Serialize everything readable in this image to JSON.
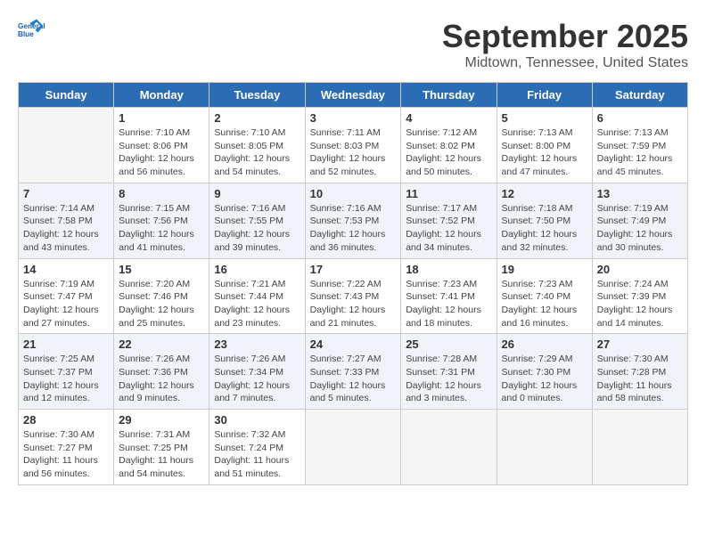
{
  "header": {
    "title": "September 2025",
    "location": "Midtown, Tennessee, United States",
    "logo_general": "General",
    "logo_blue": "Blue"
  },
  "weekdays": [
    "Sunday",
    "Monday",
    "Tuesday",
    "Wednesday",
    "Thursday",
    "Friday",
    "Saturday"
  ],
  "weeks": [
    [
      {
        "day": "",
        "info": ""
      },
      {
        "day": "1",
        "info": "Sunrise: 7:10 AM\nSunset: 8:06 PM\nDaylight: 12 hours\nand 56 minutes."
      },
      {
        "day": "2",
        "info": "Sunrise: 7:10 AM\nSunset: 8:05 PM\nDaylight: 12 hours\nand 54 minutes."
      },
      {
        "day": "3",
        "info": "Sunrise: 7:11 AM\nSunset: 8:03 PM\nDaylight: 12 hours\nand 52 minutes."
      },
      {
        "day": "4",
        "info": "Sunrise: 7:12 AM\nSunset: 8:02 PM\nDaylight: 12 hours\nand 50 minutes."
      },
      {
        "day": "5",
        "info": "Sunrise: 7:13 AM\nSunset: 8:00 PM\nDaylight: 12 hours\nand 47 minutes."
      },
      {
        "day": "6",
        "info": "Sunrise: 7:13 AM\nSunset: 7:59 PM\nDaylight: 12 hours\nand 45 minutes."
      }
    ],
    [
      {
        "day": "7",
        "info": "Sunrise: 7:14 AM\nSunset: 7:58 PM\nDaylight: 12 hours\nand 43 minutes."
      },
      {
        "day": "8",
        "info": "Sunrise: 7:15 AM\nSunset: 7:56 PM\nDaylight: 12 hours\nand 41 minutes."
      },
      {
        "day": "9",
        "info": "Sunrise: 7:16 AM\nSunset: 7:55 PM\nDaylight: 12 hours\nand 39 minutes."
      },
      {
        "day": "10",
        "info": "Sunrise: 7:16 AM\nSunset: 7:53 PM\nDaylight: 12 hours\nand 36 minutes."
      },
      {
        "day": "11",
        "info": "Sunrise: 7:17 AM\nSunset: 7:52 PM\nDaylight: 12 hours\nand 34 minutes."
      },
      {
        "day": "12",
        "info": "Sunrise: 7:18 AM\nSunset: 7:50 PM\nDaylight: 12 hours\nand 32 minutes."
      },
      {
        "day": "13",
        "info": "Sunrise: 7:19 AM\nSunset: 7:49 PM\nDaylight: 12 hours\nand 30 minutes."
      }
    ],
    [
      {
        "day": "14",
        "info": "Sunrise: 7:19 AM\nSunset: 7:47 PM\nDaylight: 12 hours\nand 27 minutes."
      },
      {
        "day": "15",
        "info": "Sunrise: 7:20 AM\nSunset: 7:46 PM\nDaylight: 12 hours\nand 25 minutes."
      },
      {
        "day": "16",
        "info": "Sunrise: 7:21 AM\nSunset: 7:44 PM\nDaylight: 12 hours\nand 23 minutes."
      },
      {
        "day": "17",
        "info": "Sunrise: 7:22 AM\nSunset: 7:43 PM\nDaylight: 12 hours\nand 21 minutes."
      },
      {
        "day": "18",
        "info": "Sunrise: 7:23 AM\nSunset: 7:41 PM\nDaylight: 12 hours\nand 18 minutes."
      },
      {
        "day": "19",
        "info": "Sunrise: 7:23 AM\nSunset: 7:40 PM\nDaylight: 12 hours\nand 16 minutes."
      },
      {
        "day": "20",
        "info": "Sunrise: 7:24 AM\nSunset: 7:39 PM\nDaylight: 12 hours\nand 14 minutes."
      }
    ],
    [
      {
        "day": "21",
        "info": "Sunrise: 7:25 AM\nSunset: 7:37 PM\nDaylight: 12 hours\nand 12 minutes."
      },
      {
        "day": "22",
        "info": "Sunrise: 7:26 AM\nSunset: 7:36 PM\nDaylight: 12 hours\nand 9 minutes."
      },
      {
        "day": "23",
        "info": "Sunrise: 7:26 AM\nSunset: 7:34 PM\nDaylight: 12 hours\nand 7 minutes."
      },
      {
        "day": "24",
        "info": "Sunrise: 7:27 AM\nSunset: 7:33 PM\nDaylight: 12 hours\nand 5 minutes."
      },
      {
        "day": "25",
        "info": "Sunrise: 7:28 AM\nSunset: 7:31 PM\nDaylight: 12 hours\nand 3 minutes."
      },
      {
        "day": "26",
        "info": "Sunrise: 7:29 AM\nSunset: 7:30 PM\nDaylight: 12 hours\nand 0 minutes."
      },
      {
        "day": "27",
        "info": "Sunrise: 7:30 AM\nSunset: 7:28 PM\nDaylight: 11 hours\nand 58 minutes."
      }
    ],
    [
      {
        "day": "28",
        "info": "Sunrise: 7:30 AM\nSunset: 7:27 PM\nDaylight: 11 hours\nand 56 minutes."
      },
      {
        "day": "29",
        "info": "Sunrise: 7:31 AM\nSunset: 7:25 PM\nDaylight: 11 hours\nand 54 minutes."
      },
      {
        "day": "30",
        "info": "Sunrise: 7:32 AM\nSunset: 7:24 PM\nDaylight: 11 hours\nand 51 minutes."
      },
      {
        "day": "",
        "info": ""
      },
      {
        "day": "",
        "info": ""
      },
      {
        "day": "",
        "info": ""
      },
      {
        "day": "",
        "info": ""
      }
    ]
  ]
}
